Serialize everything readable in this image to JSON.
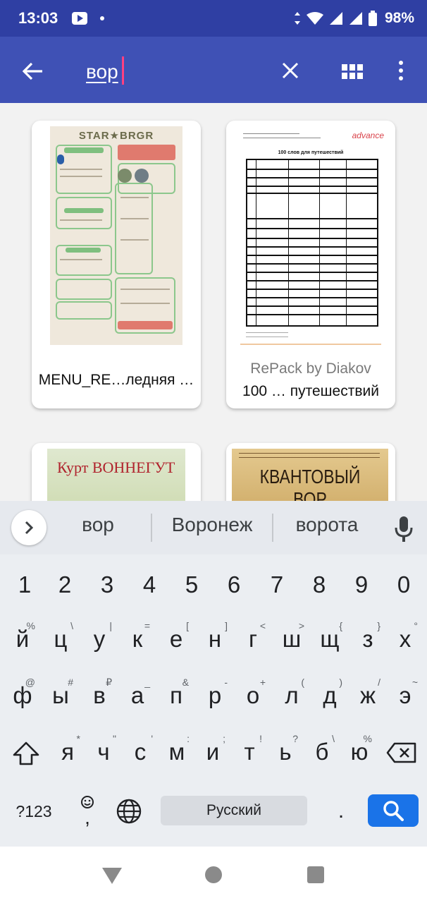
{
  "status_bar": {
    "time": "13:03",
    "battery": "98%",
    "icons": [
      "youtube-notification-icon",
      "dot-icon",
      "data-arrows-icon",
      "wifi-icon",
      "signal-icon",
      "signal-no-data-icon",
      "battery-icon"
    ]
  },
  "app_bar": {
    "search_query": "вор",
    "back_icon": "arrow-back-icon",
    "clear_icon": "close-icon",
    "view_icon": "grid-view-icon",
    "more_icon": "more-vert-icon"
  },
  "results": [
    {
      "title": "MENU_RE…ледняя …",
      "author": "",
      "thumb_heading": "STAR★BRGR"
    },
    {
      "title": "100 … путешествий",
      "author": "RePack by Diakov",
      "thumb_heading": "100 слов для путешествий",
      "thumb_logo": "advance"
    },
    {
      "title": "",
      "author": "",
      "thumb_heading": "Курт ВОННЕГУТ"
    },
    {
      "title": "",
      "author": "",
      "thumb_heading": "КВАНТОВЫЙ ВОР"
    }
  ],
  "keyboard": {
    "suggestions": [
      "вор",
      "Воронеж",
      "ворота"
    ],
    "number_row": [
      "1",
      "2",
      "3",
      "4",
      "5",
      "6",
      "7",
      "8",
      "9",
      "0"
    ],
    "row1": [
      {
        "key": "й",
        "hint": "%"
      },
      {
        "key": "ц",
        "hint": "\\"
      },
      {
        "key": "у",
        "hint": "|"
      },
      {
        "key": "к",
        "hint": "="
      },
      {
        "key": "е",
        "hint": "["
      },
      {
        "key": "н",
        "hint": "]"
      },
      {
        "key": "г",
        "hint": "<"
      },
      {
        "key": "ш",
        "hint": ">"
      },
      {
        "key": "щ",
        "hint": "{"
      },
      {
        "key": "з",
        "hint": "}"
      },
      {
        "key": "х",
        "hint": "°"
      }
    ],
    "row2": [
      {
        "key": "ф",
        "hint": "@"
      },
      {
        "key": "ы",
        "hint": "#"
      },
      {
        "key": "в",
        "hint": "₽"
      },
      {
        "key": "а",
        "hint": "_"
      },
      {
        "key": "п",
        "hint": "&"
      },
      {
        "key": "р",
        "hint": "-"
      },
      {
        "key": "о",
        "hint": "+"
      },
      {
        "key": "л",
        "hint": "("
      },
      {
        "key": "д",
        "hint": ")"
      },
      {
        "key": "ж",
        "hint": "/"
      },
      {
        "key": "э",
        "hint": "~"
      }
    ],
    "row3": [
      {
        "key": "я",
        "hint": "*"
      },
      {
        "key": "ч",
        "hint": "\""
      },
      {
        "key": "с",
        "hint": "'"
      },
      {
        "key": "м",
        "hint": ":"
      },
      {
        "key": "и",
        "hint": ";"
      },
      {
        "key": "т",
        "hint": "!"
      },
      {
        "key": "ь",
        "hint": "?"
      },
      {
        "key": "б",
        "hint": "\\"
      },
      {
        "key": "ю",
        "hint": "%"
      }
    ],
    "symbols_label": "?123",
    "comma_label": ",",
    "space_label": "Русский",
    "period_label": ".",
    "accent_color": "#1a73e8"
  },
  "colors": {
    "status_bar": "#2f3fa3",
    "app_bar": "#3f51b5",
    "caret": "#ff4081",
    "background": "#f2f2f2"
  }
}
